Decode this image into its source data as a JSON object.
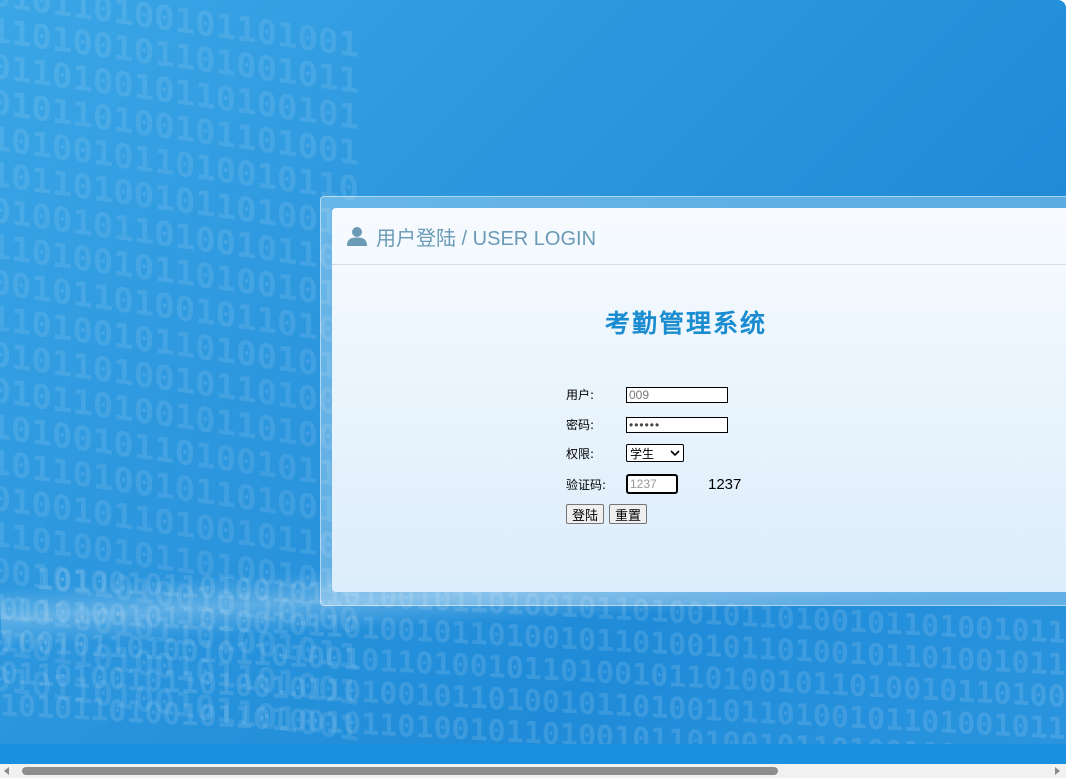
{
  "header": {
    "title": "用户登陆 / USER LOGIN",
    "icon": "user-icon"
  },
  "system_title": "考勤管理系统",
  "form": {
    "user_label": "用户:",
    "user_value": "009",
    "password_label": "密码:",
    "password_value": "••••••",
    "role_label": "权限:",
    "role_selected": "学生",
    "captcha_label": "验证码:",
    "captcha_input": "1237",
    "captcha_code": "1237",
    "login_button": "登陆",
    "reset_button": "重置"
  },
  "colors": {
    "background": "#2b95dd",
    "title": "#1a8ccf",
    "header_text": "#6a9ab5"
  }
}
